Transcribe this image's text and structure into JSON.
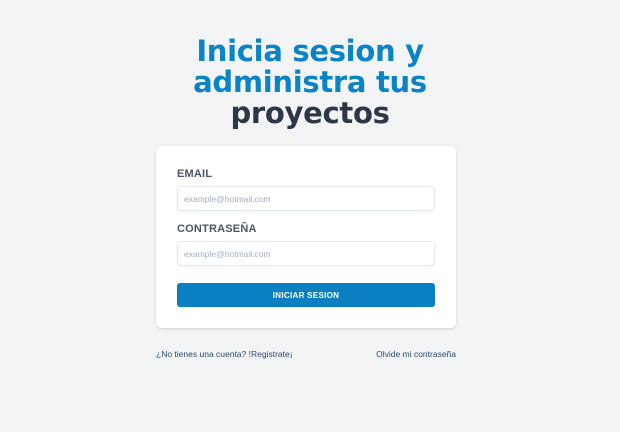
{
  "headline": {
    "line1": "Inicia sesion y",
    "line2": "administra tus",
    "line3": "proyectos"
  },
  "form": {
    "email_label": "EMAIL",
    "email_placeholder": "example@hotmail.com",
    "password_label": "CONTRASEÑA",
    "password_placeholder": "example@hotmail.com",
    "submit_label": "INICIAR SESION"
  },
  "links": {
    "register": "¿No tienes una cuenta? !Registrate¡",
    "forgot_password": "Olvide mi contraseña"
  },
  "colors": {
    "accent": "#0a84c6",
    "dark_text": "#2d3748",
    "button": "#0a7fc2",
    "background": "#f3f4f6"
  }
}
